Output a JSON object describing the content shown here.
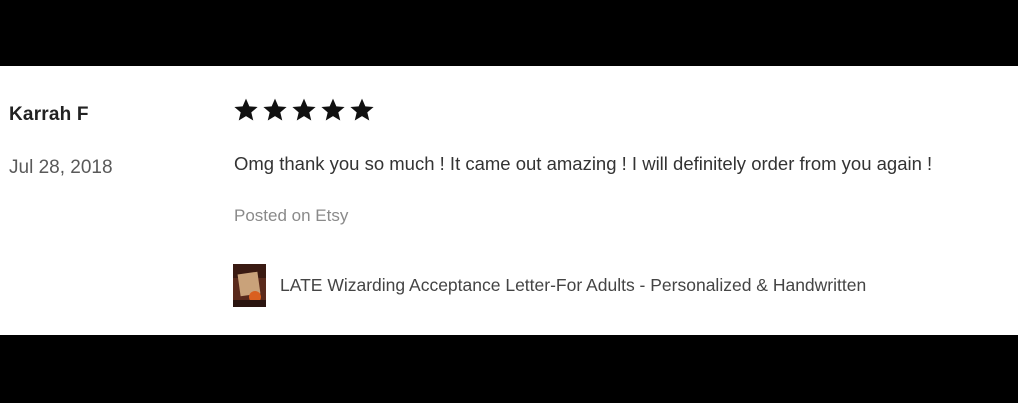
{
  "review": {
    "reviewer_name": "Karrah F",
    "date": "Jul 28, 2018",
    "rating": 5,
    "rating_max": 5,
    "text": "Omg thank you so much ! It came out amazing ! I will definitely order from you again !",
    "source": "Posted on Etsy"
  },
  "product": {
    "title": "LATE Wizarding Acceptance Letter-For Adults - Personalized & Handwritten",
    "thumbnail_icon": "product-thumbnail"
  },
  "colors": {
    "star": "#111111",
    "frame": "#000000",
    "card_background": "#ffffff",
    "muted_text": "#8a8a8a"
  }
}
